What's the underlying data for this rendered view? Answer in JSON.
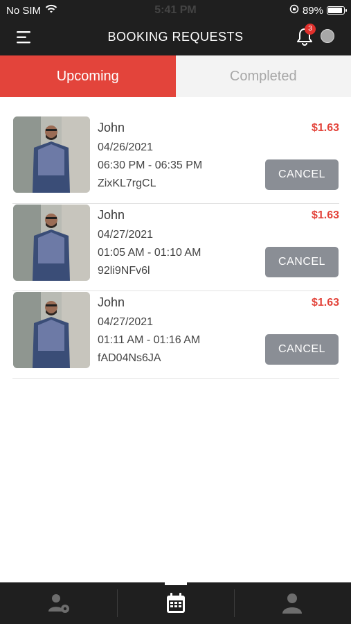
{
  "status_bar": {
    "carrier": "No SIM",
    "time": "5:41 PM",
    "battery": "89%"
  },
  "header": {
    "title": "BOOKING REQUESTS",
    "notification_count": "3"
  },
  "tabs": [
    {
      "label": "Upcoming",
      "active": true
    },
    {
      "label": "Completed",
      "active": false
    }
  ],
  "bookings": [
    {
      "name": "John",
      "date": "04/26/2021",
      "time": "06:30 PM - 06:35 PM",
      "code": "ZixKL7rgCL",
      "price": "$1.63",
      "action": "CANCEL"
    },
    {
      "name": "John",
      "date": "04/27/2021",
      "time": "01:05 AM - 01:10 AM",
      "code": "92li9NFv6l",
      "price": "$1.63",
      "action": "CANCEL"
    },
    {
      "name": "John",
      "date": "04/27/2021",
      "time": "01:11 AM - 01:16 AM",
      "code": "fAD04Ns6JA",
      "price": "$1.63",
      "action": "CANCEL"
    }
  ],
  "bottom_nav": {
    "items": [
      {
        "icon": "user-settings-icon"
      },
      {
        "icon": "calendar-icon",
        "active": true
      },
      {
        "icon": "profile-icon"
      }
    ]
  },
  "colors": {
    "accent": "#e3443b",
    "header_bg": "#1f1f1f",
    "cancel_btn": "#8a8e95"
  }
}
